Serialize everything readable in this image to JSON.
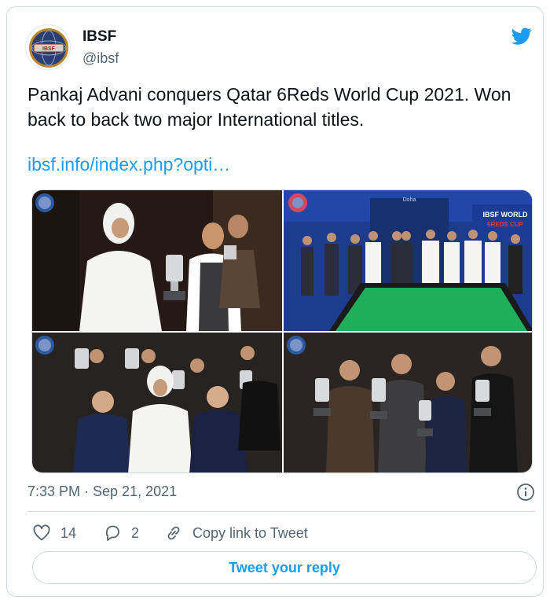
{
  "account": {
    "name": "IBSF",
    "handle": "@ibsf",
    "avatar_text": "IBSF"
  },
  "tweet": {
    "text": "Pankaj Advani conquers Qatar 6Reds World Cup 2021. Won back to back two major International titles.",
    "link": "ibsf.info/index.php?opti…",
    "timestamp": "7:33 PM · Sep 21, 2021"
  },
  "media": {
    "banner_text": "IBSF WORLD",
    "banner_sub": "6REDS CUP",
    "sponsor_text": "Doha"
  },
  "actions": {
    "like_count": "14",
    "reply_count": "2",
    "copy_link_label": "Copy link to Tweet"
  },
  "reply_button_label": "Tweet your reply",
  "colors": {
    "accent": "#1d9bf0",
    "secondary_text": "#536471",
    "border": "#cfd9de",
    "pool_table_cloth": "#1fae5a"
  },
  "icons": [
    "twitter-bird-icon",
    "info-icon",
    "heart-icon",
    "reply-bubble-icon",
    "link-icon",
    "ibsf-logo"
  ]
}
